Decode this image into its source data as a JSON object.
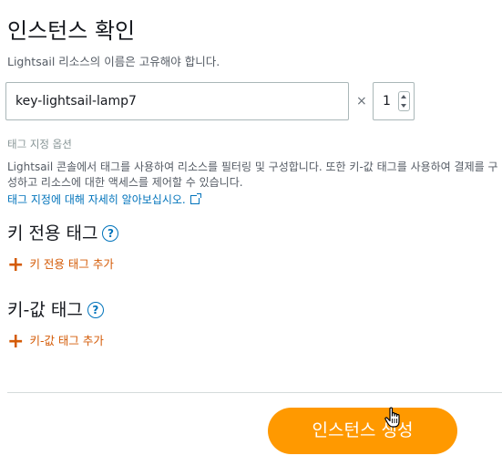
{
  "header": {
    "title": "인스턴스 확인",
    "description": "Lightsail 리소스의 이름은 고유해야 합니다."
  },
  "instance": {
    "name_value": "key-lightsail-lamp7",
    "multiplier": "×",
    "quantity": "1"
  },
  "tagging": {
    "section_label": "태그 지정 옵션",
    "description": "Lightsail 콘솔에서 태그를 사용하여 리소스를 필터링 및 구성합니다. 또한 키-값 태그를 사용하여 결제를 구성하고 리소스에 대한 액세스를 제어할 수 있습니다.",
    "learn_more_link": "태그 지정에 대해 자세히 알아보십시오.",
    "key_only": {
      "title": "키 전용 태그",
      "help": "?",
      "add_label": "키 전용 태그 추가"
    },
    "key_value": {
      "title": "키-값 태그",
      "help": "?",
      "add_label": "키-값 태그 추가"
    }
  },
  "footer": {
    "create_button": "인스턴스 생성"
  },
  "colors": {
    "accent": "#ff9900",
    "link": "#0073bb",
    "add_action": "#d45b07"
  }
}
